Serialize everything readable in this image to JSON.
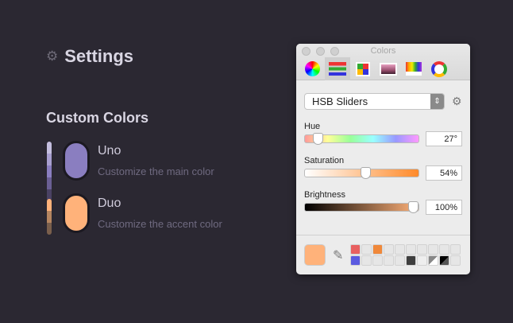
{
  "settings": {
    "title": "Settings",
    "section": "Custom Colors",
    "colors": [
      {
        "name": "Uno",
        "desc": "Customize the main color",
        "color": "#8a7ec0",
        "shades": [
          "#c4bedf",
          "#a89fd0",
          "#8a7ec0",
          "#6a5f94",
          "#4a4264"
        ]
      },
      {
        "name": "Duo",
        "desc": "Customize the accent color",
        "color": "#ffb27a",
        "shades": [
          "#ffb27a",
          "#b58560",
          "#7a5f4c"
        ]
      }
    ]
  },
  "panel": {
    "title": "Colors",
    "mode": "HSB Sliders",
    "sliders": [
      {
        "label": "Hue",
        "value": "27°",
        "fraction": 0.075
      },
      {
        "label": "Saturation",
        "value": "54%",
        "fraction": 0.54
      },
      {
        "label": "Brightness",
        "value": "100%",
        "fraction": 1
      }
    ],
    "current_color": "#ffb27a",
    "swatches": [
      "#e86060",
      "",
      "#f0883a",
      "",
      "",
      "",
      "",
      "",
      "",
      "",
      "#5a5ae0",
      "",
      "",
      "",
      "",
      "#3e3e3e",
      "#eeeeee",
      "gw",
      "bk",
      ""
    ]
  }
}
